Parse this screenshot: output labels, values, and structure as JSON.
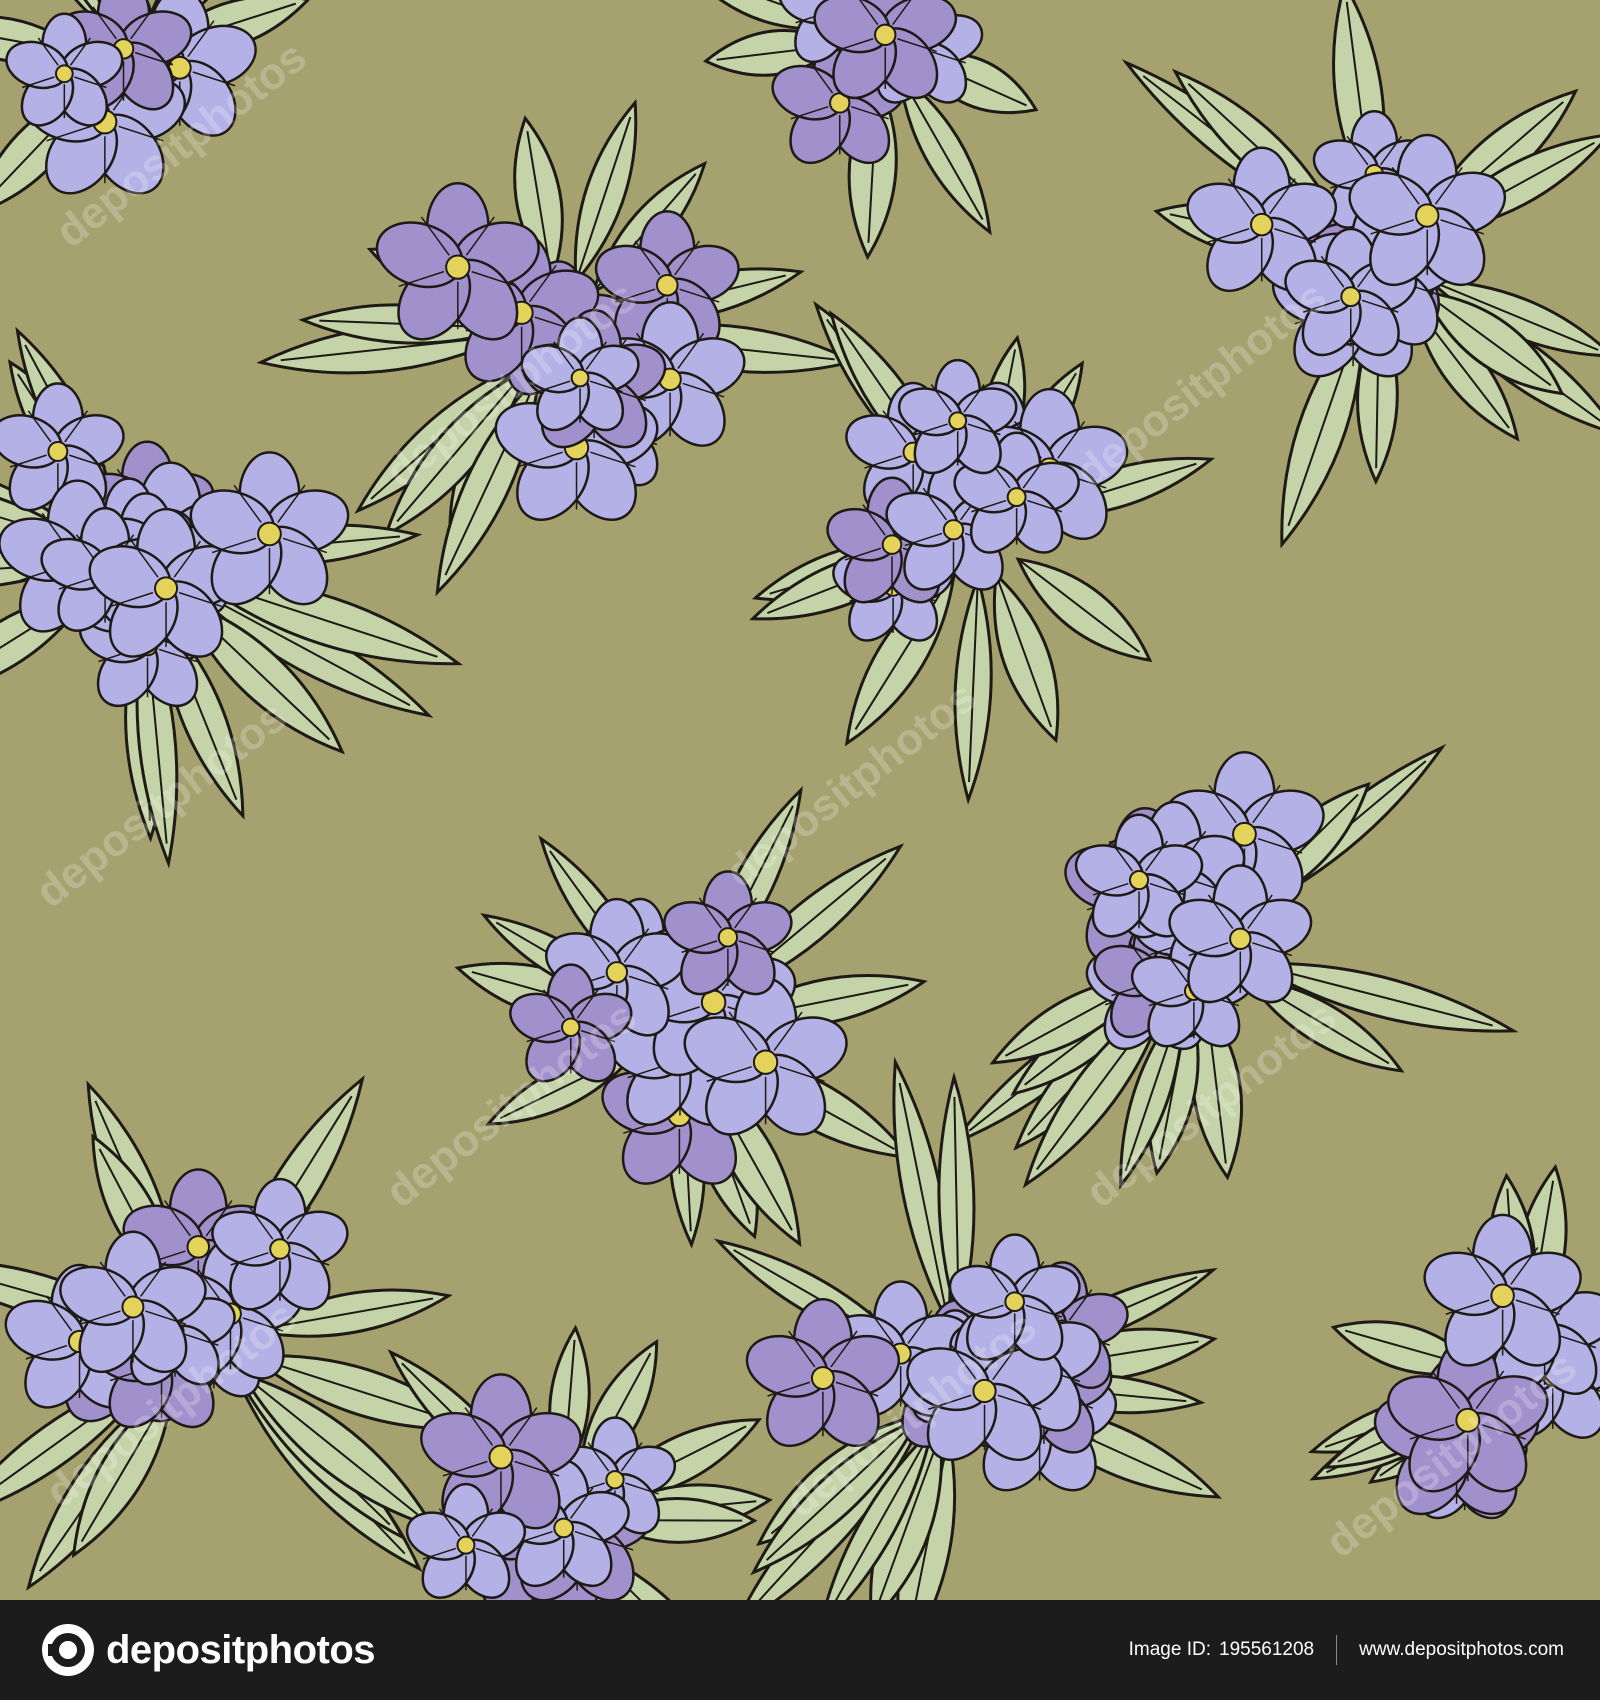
{
  "image": {
    "description_colors": {
      "background": "#a6a270",
      "flower_light": "#b4b1e6",
      "flower_dark": "#a090cc",
      "leaf": "#c4d4a8",
      "outline": "#1e1a16",
      "stamen": "#e4d35a"
    }
  },
  "watermark": {
    "text": "depositphotos"
  },
  "footer": {
    "brand": "depositphotos",
    "image_id_label": "Image ID:",
    "image_id": "195561208",
    "site_url": "www.depositphotos.com"
  }
}
